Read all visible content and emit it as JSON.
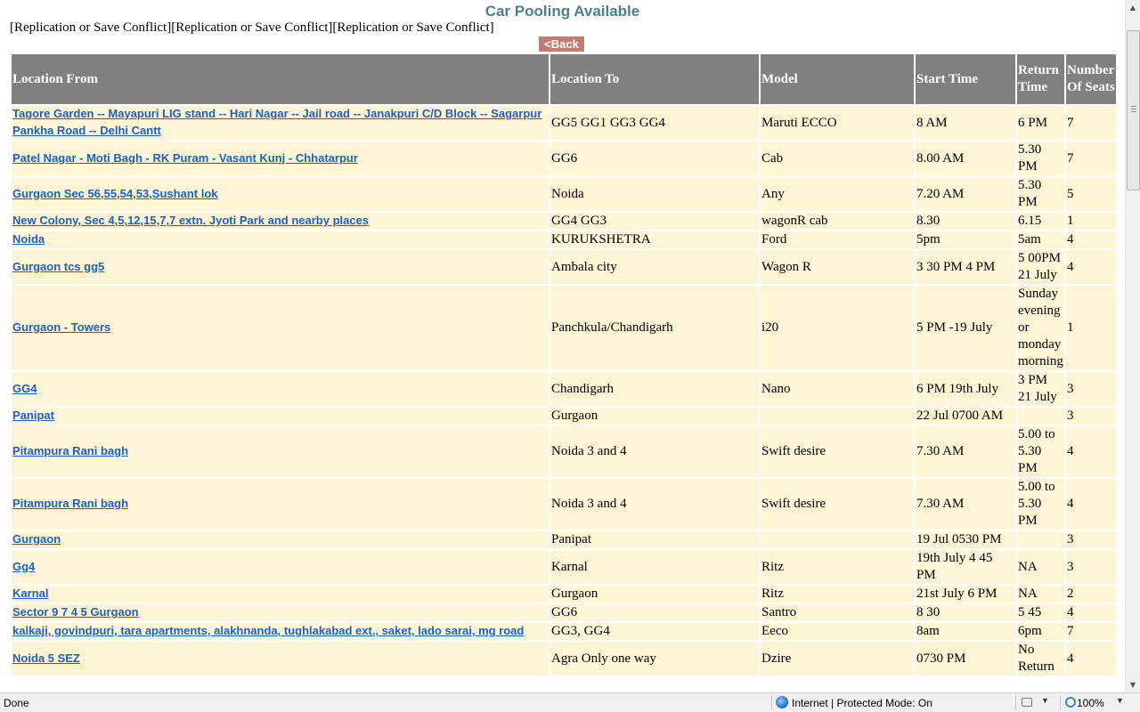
{
  "page": {
    "title": "Car Pooling Available",
    "conflict_text": "[Replication or Save Conflict][Replication or Save Conflict][Replication or Save Conflict]",
    "back_label": "<Back"
  },
  "table": {
    "headers": [
      "Location From",
      "Location To",
      "Model",
      "Start Time",
      "Return Time",
      "Number Of Seats"
    ],
    "rows": [
      {
        "from": "Tagore Garden -- Mayapuri LIG stand -- Hari Nagar -- Jail road -- Janakpuri C/D Block -- Sagarpur Pankha Road -- Delhi Cantt",
        "to": "GG5 GG1 GG3 GG4",
        "model": "Maruti ECCO",
        "start": "8 AM",
        "ret": "6 PM",
        "seats": "7"
      },
      {
        "from": "Patel Nagar - Moti Bagh - RK Puram - Vasant Kunj - Chhatarpur",
        "to": "GG6",
        "model": "Cab",
        "start": "8.00 AM",
        "ret": "5.30 PM",
        "seats": "7"
      },
      {
        "from": "Gurgaon Sec 56,55,54,53,Sushant lok",
        "to": "Noida",
        "model": "Any",
        "start": "7.20 AM",
        "ret": "5.30 PM",
        "seats": "5"
      },
      {
        "from": "New Colony, Sec 4,5,12,15,7,7 extn. Jyoti Park and nearby places",
        "to": "GG4 GG3",
        "model": "wagonR cab",
        "start": "8.30",
        "ret": "6.15",
        "seats": "1"
      },
      {
        "from": "Noida",
        "to": "KURUKSHETRA",
        "model": "Ford",
        "start": "5pm",
        "ret": "5am",
        "seats": "4"
      },
      {
        "from": "Gurgaon tcs gg5",
        "to": "Ambala city",
        "model": "Wagon R",
        "start": "3 30 PM 4 PM",
        "ret": "5 00PM 21 July",
        "seats": "4"
      },
      {
        "from": "Gurgaon - Towers",
        "to": "Panchkula/Chandigarh",
        "model": "i20",
        "start": "5 PM -19 July",
        "ret": "Sunday evening or monday morning",
        "seats": "1"
      },
      {
        "from": "GG4",
        "to": "Chandigarh",
        "model": "Nano",
        "start": "6 PM 19th July",
        "ret": "3 PM 21 July",
        "seats": "3"
      },
      {
        "from": "Panipat",
        "to": "Gurgaon",
        "model": "",
        "start": "22 Jul 0700 AM",
        "ret": "",
        "seats": "3"
      },
      {
        "from": "Pitampura Rani bagh",
        "to": "Noida 3 and 4",
        "model": "Swift desire",
        "start": "7.30 AM",
        "ret": "5.00 to 5.30 PM",
        "seats": "4"
      },
      {
        "from": "Pitampura Rani bagh",
        "to": "Noida 3 and 4",
        "model": "Swift desire",
        "start": "7.30 AM",
        "ret": "5.00 to 5.30 PM",
        "seats": "4"
      },
      {
        "from": "Gurgaon",
        "to": "Panipat",
        "model": "",
        "start": "19 Jul 0530 PM",
        "ret": "",
        "seats": "3"
      },
      {
        "from": "Gg4",
        "to": "Karnal",
        "model": "Ritz",
        "start": "19th July 4 45 PM",
        "ret": "NA",
        "seats": "3"
      },
      {
        "from": "Karnal",
        "to": "Gurgaon",
        "model": "Ritz",
        "start": "21st July 6 PM",
        "ret": "NA",
        "seats": "2"
      },
      {
        "from": "Sector 9 7 4 5 Gurgaon",
        "to": "GG6",
        "model": "Santro",
        "start": "8 30",
        "ret": "5 45",
        "seats": "4"
      },
      {
        "from": "kalkaji, govindpuri, tara apartments, alakhnanda, tughlakabad ext., saket, lado sarai, mg road",
        "to": "GG3, GG4",
        "model": "Eeco",
        "start": "8am",
        "ret": "6pm",
        "seats": "7"
      },
      {
        "from": "Noida 5 SEZ",
        "to": "Agra Only one way",
        "model": "Dzire",
        "start": "0730 PM",
        "ret": "No Return",
        "seats": "4"
      }
    ]
  },
  "statusbar": {
    "status": "Done",
    "zone": "Internet | Protected Mode: On",
    "zoom": "100%"
  },
  "icons": {
    "scroll_up": "scroll-up-arrow-icon",
    "scroll_down": "scroll-down-arrow-icon",
    "zone": "globe-icon",
    "zoom": "magnifier-icon"
  }
}
